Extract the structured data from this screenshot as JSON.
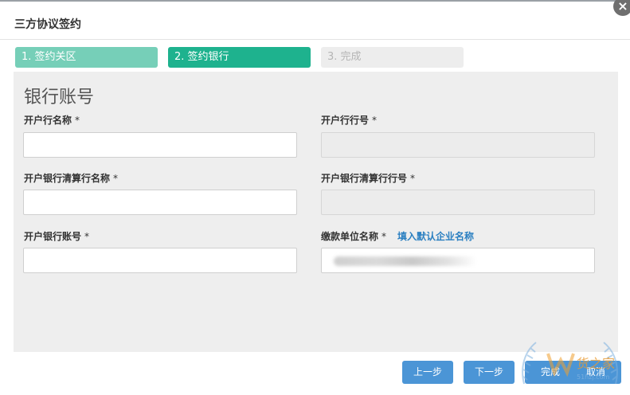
{
  "dialog": {
    "title": "三方协议签约",
    "close_icon": "×"
  },
  "steps": [
    {
      "label": "1. 签约关区",
      "state": "done"
    },
    {
      "label": "2. 签约银行",
      "state": "active"
    },
    {
      "label": "3. 完成",
      "state": "pending"
    }
  ],
  "section": {
    "title": "银行账号"
  },
  "fields": {
    "bank_name": {
      "label": "开户行名称",
      "required": "*",
      "value": ""
    },
    "bank_code": {
      "label": "开户行行号",
      "required": "*",
      "value": ""
    },
    "clearing_bank_name": {
      "label": "开户银行清算行名称",
      "required": "*",
      "value": ""
    },
    "clearing_bank_code": {
      "label": "开户银行清算行行号",
      "required": "*",
      "value": ""
    },
    "account_number": {
      "label": "开户银行账号",
      "required": "*",
      "value": ""
    },
    "payer_name": {
      "label": "缴款单位名称",
      "required": "*",
      "value": ""
    }
  },
  "links": {
    "fill_default_company": "填入默认企业名称"
  },
  "buttons": {
    "prev": "上一步",
    "next": "下一步",
    "finish": "完成",
    "cancel": "取消"
  },
  "watermark": {
    "text": "货之家",
    "url_text": "51hzj.com"
  },
  "colors": {
    "step_done": "#76cfb8",
    "step_active": "#1eb28e",
    "step_pending": "#ededed",
    "button": "#4b95d6",
    "link": "#2a7fc1",
    "panel": "#eeeeee"
  }
}
